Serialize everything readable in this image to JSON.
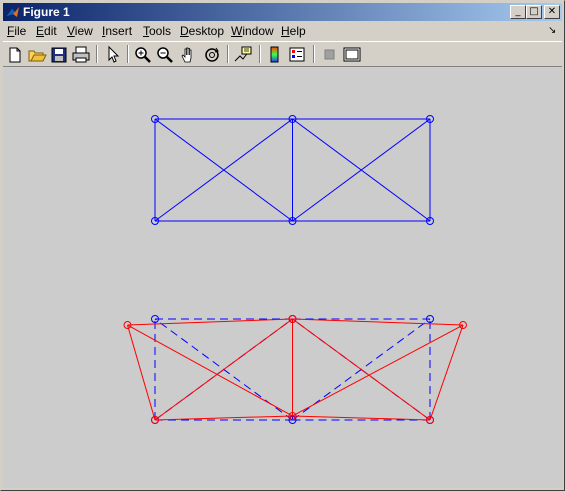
{
  "window": {
    "title": "Figure 1"
  },
  "title_buttons": {
    "minimize": "_",
    "maximize": "□",
    "close": "✕"
  },
  "menu": {
    "items": [
      {
        "label": "File",
        "key": "F",
        "rest": "ile"
      },
      {
        "label": "Edit",
        "key": "E",
        "rest": "dit"
      },
      {
        "label": "View",
        "key": "V",
        "rest": "iew"
      },
      {
        "label": "Insert",
        "key": "I",
        "rest": "nsert"
      },
      {
        "label": "Tools",
        "key": "T",
        "rest": "ools"
      },
      {
        "label": "Desktop",
        "key": "D",
        "rest": "esktop"
      },
      {
        "label": "Window",
        "key": "W",
        "rest": "indow"
      },
      {
        "label": "Help",
        "key": "H",
        "rest": "elp"
      }
    ],
    "dock_glyph": "↘"
  },
  "toolbar": {
    "icons": [
      "new-file-icon",
      "open-file-icon",
      "save-icon",
      "print-icon",
      "pointer-icon",
      "zoom-in-icon",
      "zoom-out-icon",
      "pan-hand-icon",
      "rotate-3d-icon",
      "data-cursor-icon",
      "colorbar-icon",
      "legend-icon",
      "hide-plot-tools-icon",
      "show-plot-tools-icon"
    ]
  },
  "colors": {
    "original_truss": "#0000ff",
    "deformed_truss": "#ff0000",
    "figure_bg": "#cccccc"
  },
  "truss": {
    "nodes": [
      [
        0,
        0
      ],
      [
        1,
        0
      ],
      [
        2,
        0
      ],
      [
        0,
        1
      ],
      [
        1,
        1
      ],
      [
        2,
        1
      ]
    ],
    "members": [
      [
        0,
        1
      ],
      [
        1,
        2
      ],
      [
        3,
        4
      ],
      [
        4,
        5
      ],
      [
        0,
        3
      ],
      [
        1,
        4
      ],
      [
        2,
        5
      ],
      [
        0,
        4
      ],
      [
        1,
        3
      ],
      [
        1,
        5
      ],
      [
        2,
        4
      ]
    ],
    "deformed_nodes": [
      [
        0,
        0
      ],
      [
        1,
        0.04
      ],
      [
        2,
        0
      ],
      [
        -0.2,
        0.94
      ],
      [
        1,
        1
      ],
      [
        2.24,
        0.94
      ]
    ]
  }
}
